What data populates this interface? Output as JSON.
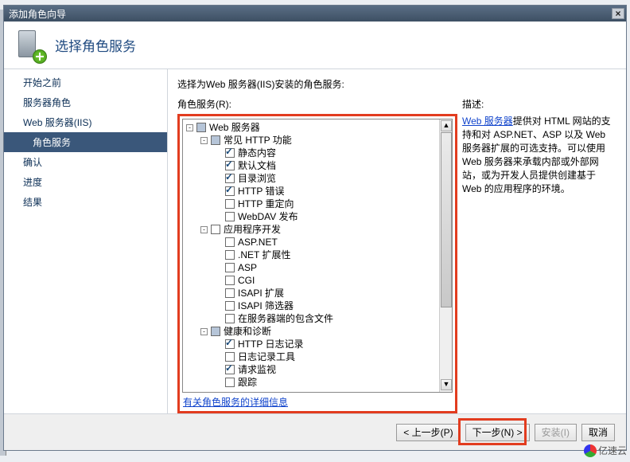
{
  "window": {
    "title": "添加角色向导"
  },
  "header": {
    "title": "选择角色服务"
  },
  "sidebar": {
    "items": [
      {
        "label": "开始之前"
      },
      {
        "label": "服务器角色"
      },
      {
        "label": "Web 服务器(IIS)"
      },
      {
        "label": "角色服务",
        "selected": true,
        "sub": true
      },
      {
        "label": "确认"
      },
      {
        "label": "进度"
      },
      {
        "label": "结果"
      }
    ]
  },
  "main": {
    "prompt": "选择为Web 服务器(IIS)安装的角色服务:",
    "subprompt": "角色服务(R):",
    "tree": [
      {
        "depth": 0,
        "exp": "-",
        "state": "gray",
        "label": "Web 服务器"
      },
      {
        "depth": 1,
        "exp": "-",
        "state": "gray",
        "label": "常见 HTTP 功能"
      },
      {
        "depth": 2,
        "state": "checked",
        "label": "静态内容"
      },
      {
        "depth": 2,
        "state": "checked",
        "label": "默认文档"
      },
      {
        "depth": 2,
        "state": "checked",
        "label": "目录浏览"
      },
      {
        "depth": 2,
        "state": "checked",
        "label": "HTTP 错误"
      },
      {
        "depth": 2,
        "state": "",
        "label": "HTTP 重定向"
      },
      {
        "depth": 2,
        "state": "",
        "label": "WebDAV 发布"
      },
      {
        "depth": 1,
        "exp": "-",
        "state": "",
        "label": "应用程序开发"
      },
      {
        "depth": 2,
        "state": "",
        "label": "ASP.NET"
      },
      {
        "depth": 2,
        "state": "",
        "label": ".NET 扩展性"
      },
      {
        "depth": 2,
        "state": "",
        "label": "ASP"
      },
      {
        "depth": 2,
        "state": "",
        "label": "CGI"
      },
      {
        "depth": 2,
        "state": "",
        "label": "ISAPI 扩展"
      },
      {
        "depth": 2,
        "state": "",
        "label": "ISAPI 筛选器"
      },
      {
        "depth": 2,
        "state": "",
        "label": "在服务器端的包含文件"
      },
      {
        "depth": 1,
        "exp": "-",
        "state": "gray",
        "label": "健康和诊断"
      },
      {
        "depth": 2,
        "state": "checked",
        "label": "HTTP 日志记录"
      },
      {
        "depth": 2,
        "state": "",
        "label": "日志记录工具"
      },
      {
        "depth": 2,
        "state": "checked",
        "label": "请求监视"
      },
      {
        "depth": 2,
        "state": "",
        "label": "跟踪"
      }
    ],
    "details_link": "有关角色服务的详细信息",
    "desc_title": "描述:",
    "desc_link": "Web 服务器",
    "desc_text": "提供对 HTML 网站的支持和对 ASP.NET、ASP 以及 Web 服务器扩展的可选支持。可以使用 Web 服务器来承载内部或外部网站，或为开发人员提供创建基于 Web 的应用程序的环境。"
  },
  "footer": {
    "prev": "< 上一步(P)",
    "next": "下一步(N) >",
    "install": "安装(I)",
    "cancel": "取消"
  },
  "watermark": "亿速云"
}
